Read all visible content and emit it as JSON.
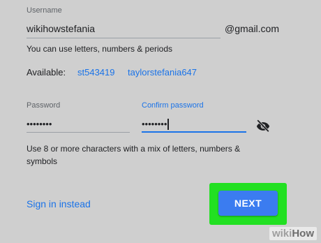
{
  "username": {
    "label": "Username",
    "value": "wikihowstefania",
    "domain_suffix": "@gmail.com",
    "helper": "You can use letters, numbers & periods"
  },
  "available": {
    "label": "Available:",
    "options": [
      "st543419",
      "taylorstefania647"
    ]
  },
  "password": {
    "label": "Password",
    "masked_value": "••••••••"
  },
  "confirm_password": {
    "label": "Confirm password",
    "masked_value": "••••••••"
  },
  "password_hint": "Use 8 or more characters with a mix of letters, numbers & symbols",
  "actions": {
    "sign_in_label": "Sign in instead",
    "next_label": "NEXT"
  },
  "icons": {
    "toggle_visibility": "eye-off-icon"
  },
  "watermark": {
    "part1": "wiki",
    "part2": "How"
  },
  "colors": {
    "accent": "#1a73e8",
    "next_button": "#3b7cf0",
    "highlight_frame": "#22e022",
    "background": "#cfcfcf"
  }
}
